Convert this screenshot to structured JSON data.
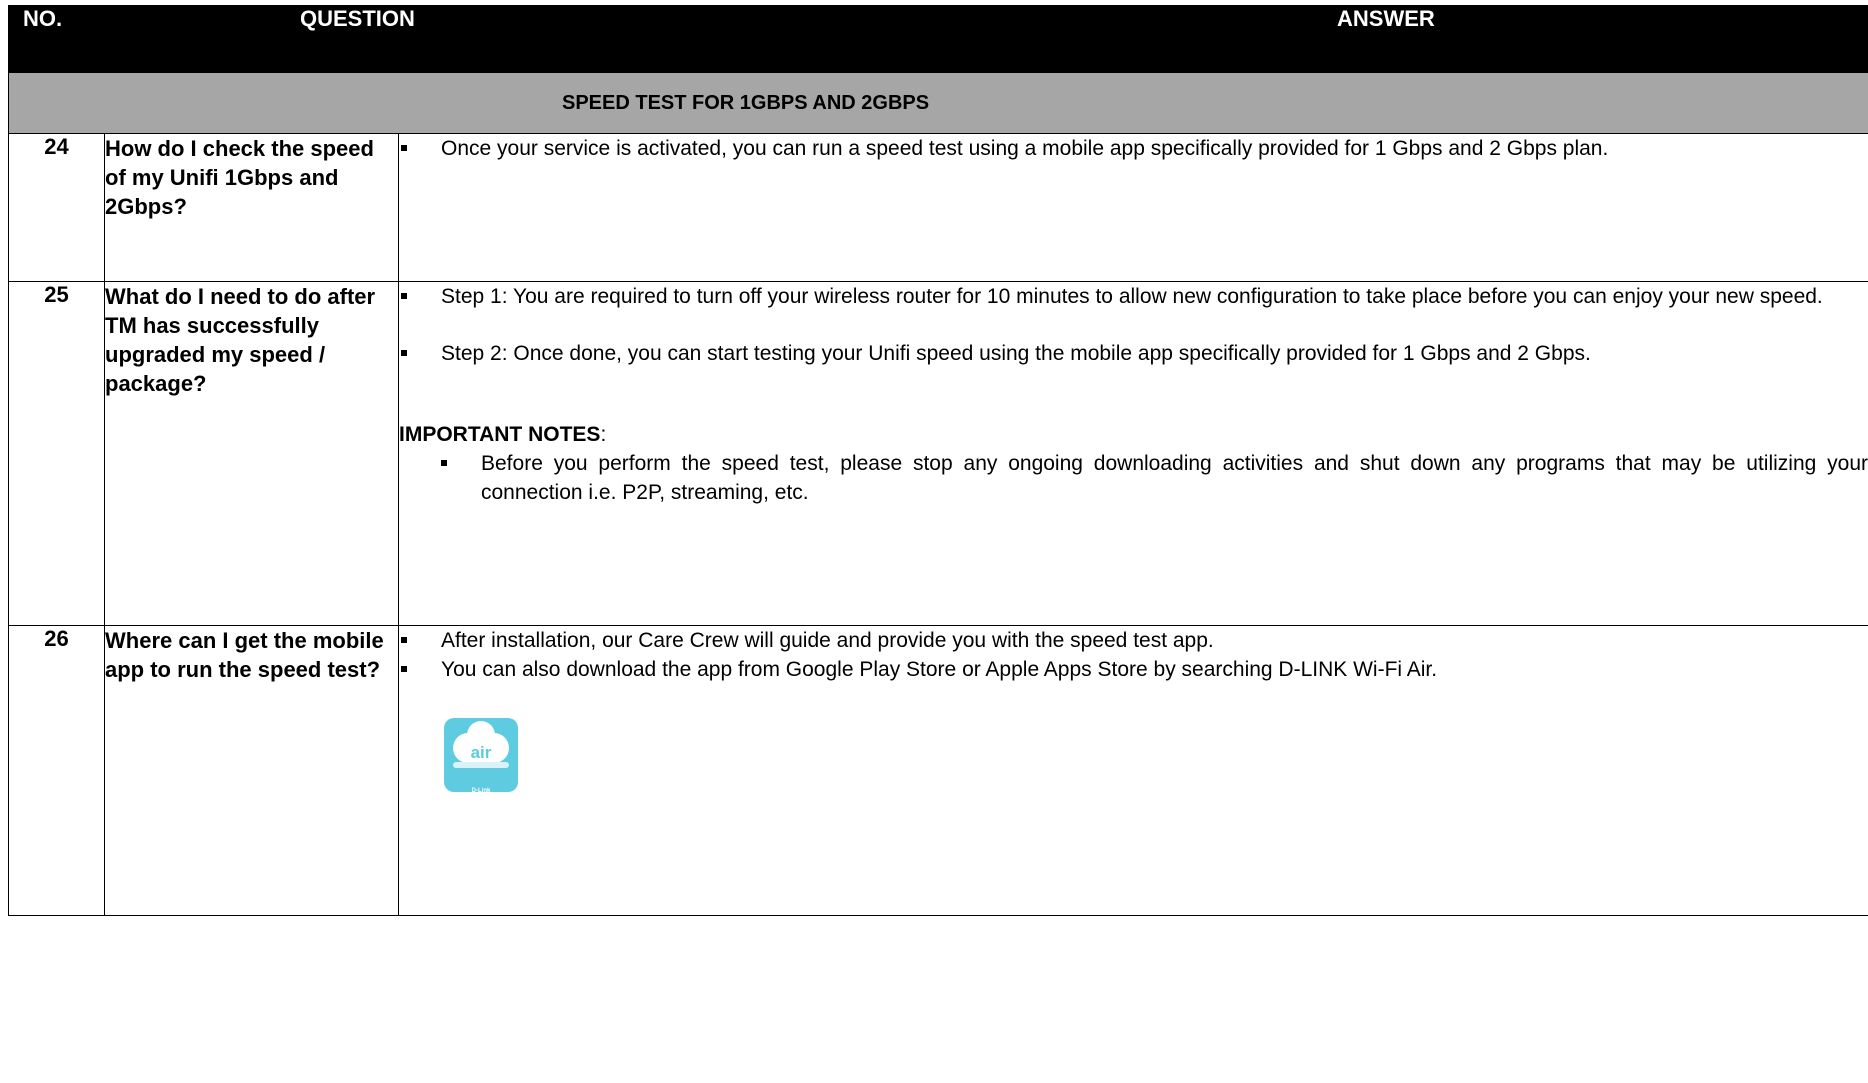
{
  "header": {
    "no": "NO.",
    "question": "QUESTION",
    "answer": "ANSWER"
  },
  "section_title": "SPEED TEST FOR 1GBPS AND 2GBPS",
  "rows": [
    {
      "no": "24",
      "question": "How do I check the speed of my Unifi 1Gbps and 2Gbps?",
      "bullets": [
        "Once your service is activated, you can run a speed test using a mobile app specifically provided for 1 Gbps and 2 Gbps plan."
      ]
    },
    {
      "no": "25",
      "question": "What do I need to do after TM has successfully upgraded my speed / package?",
      "bullets": [
        "Step 1: You are required to turn off your wireless router for 10 minutes to allow new configuration to take place before you can enjoy your new speed.",
        "Step 2: Once done, you can start testing your Unifi speed using the mobile app specifically provided for 1 Gbps and 2 Gbps."
      ],
      "notes_title": "IMPORTANT NOTES",
      "notes_suffix": ":",
      "notes": [
        "Before you perform the speed test, please stop any ongoing downloading activities and shut down any programs that may be utilizing your connection i.e. P2P, streaming, etc."
      ]
    },
    {
      "no": "26",
      "question": "Where can I get the mobile app to run the speed test?",
      "bullets": [
        "After installation, our Care Crew will guide and provide you with the speed test app.",
        "You can also download the app from Google Play Store or Apple Apps Store by searching D-LINK Wi-Fi Air."
      ],
      "app_icon": {
        "word": "air",
        "brand": "D-Link",
        "color": "#5fcbe0"
      }
    }
  ]
}
